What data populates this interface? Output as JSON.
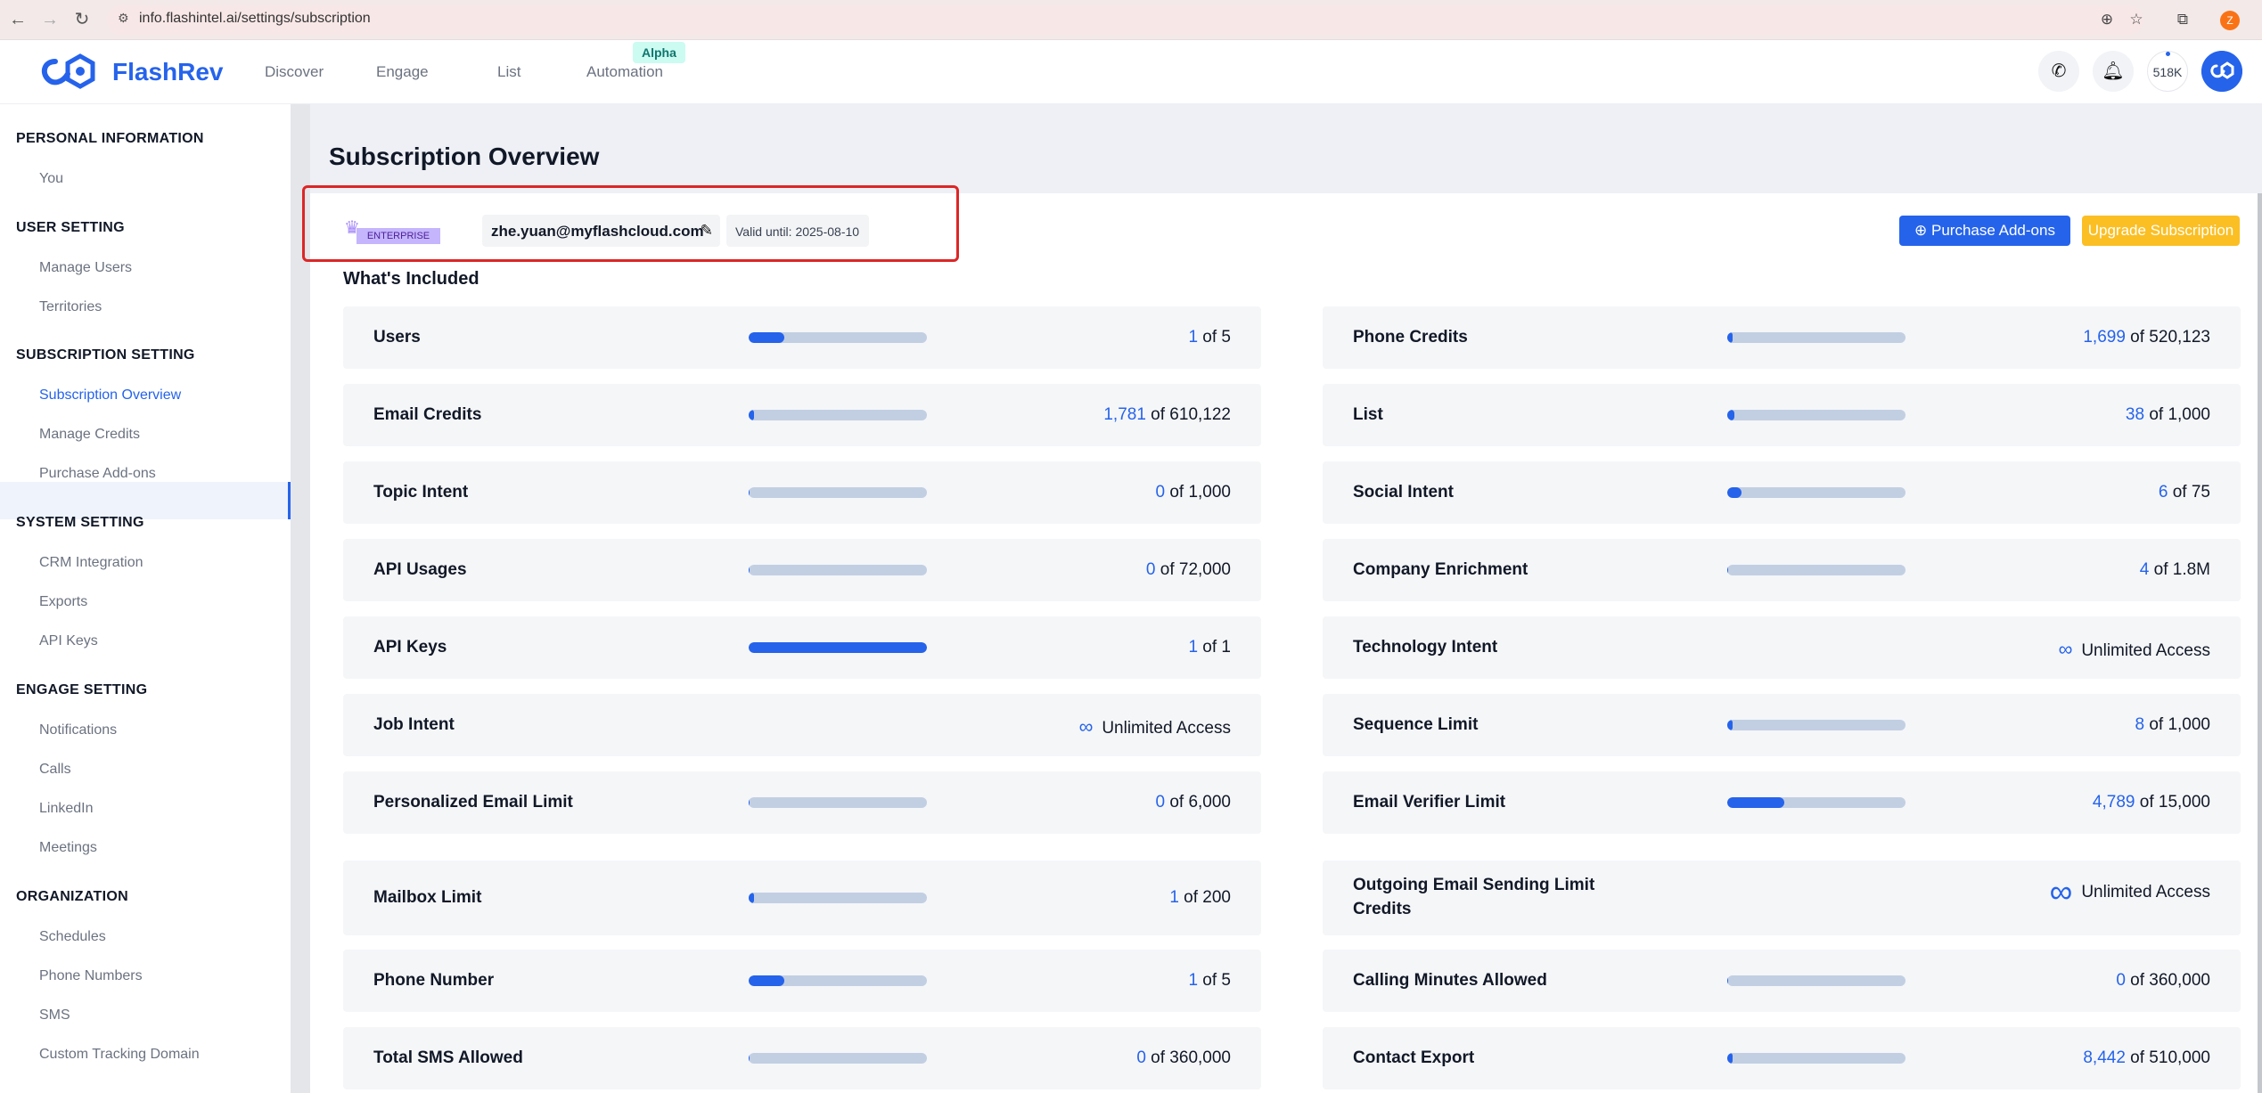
{
  "browser": {
    "url": "info.flashintel.ai/settings/subscription",
    "profile_initial": "Z"
  },
  "app": {
    "brand": "FlashRev",
    "nav": [
      "Discover",
      "Engage",
      "List",
      "Automation"
    ],
    "alpha_badge": "Alpha",
    "credits": "518K",
    "brand_color": "#2563eb"
  },
  "sidebar": {
    "sections": [
      {
        "title": "PERSONAL INFORMATION",
        "items": [
          "You"
        ]
      },
      {
        "title": "USER SETTING",
        "items": [
          "Manage Users",
          "Territories"
        ]
      },
      {
        "title": "SUBSCRIPTION SETTING",
        "items": [
          "Subscription Overview",
          "Manage Credits",
          "Purchase Add-ons"
        ]
      },
      {
        "title": "SYSTEM SETTING",
        "items": [
          "CRM Integration",
          "Exports",
          "API Keys"
        ]
      },
      {
        "title": "ENGAGE SETTING",
        "items": [
          "Notifications",
          "Calls",
          "LinkedIn",
          "Meetings"
        ]
      },
      {
        "title": "ORGANIZATION",
        "items": [
          "Schedules",
          "Phone Numbers",
          "SMS",
          "Custom Tracking Domain"
        ]
      }
    ],
    "active_item": "Subscription Overview"
  },
  "page": {
    "title": "Subscription Overview",
    "plan_badge": "ENTERPRISE",
    "email": "zhe.yuan@myflashcloud.com",
    "valid_until": "Valid until: 2025-08-10",
    "purchase_button": "Purchase Add-ons",
    "upgrade_button": "Upgrade Subscription",
    "included_title": "What's Included",
    "unlimited_text": "Unlimited Access"
  },
  "usage_left": [
    {
      "label": "Users",
      "used": "1",
      "total": "of 5",
      "fraction": 0.2
    },
    {
      "label": "Email Credits",
      "used": "1,781",
      "total": "of 610,122",
      "fraction": 0.003
    },
    {
      "label": "Topic Intent",
      "used": "0",
      "total": "of 1,000",
      "fraction": 0
    },
    {
      "label": "API Usages",
      "used": "0",
      "total": "of 72,000",
      "fraction": 0
    },
    {
      "label": "API Keys",
      "used": "1",
      "total": "of 1",
      "fraction": 1
    },
    {
      "label": "Job Intent",
      "unlimited": true
    },
    {
      "label": "Personalized Email Limit",
      "used": "0",
      "total": "of 6,000",
      "fraction": 0
    },
    {
      "label": "Mailbox Limit",
      "used": "1",
      "total": "of 200",
      "fraction": 0.005
    },
    {
      "label": "Phone Number",
      "used": "1",
      "total": "of 5",
      "fraction": 0.2
    },
    {
      "label": "Total SMS Allowed",
      "used": "0",
      "total": "of 360,000",
      "fraction": 0
    }
  ],
  "usage_right": [
    {
      "label": "Phone Credits",
      "used": "1,699",
      "total": "of 520,123",
      "fraction": 0.003
    },
    {
      "label": "List",
      "used": "38",
      "total": "of 1,000",
      "fraction": 0.038
    },
    {
      "label": "Social Intent",
      "used": "6",
      "total": "of 75",
      "fraction": 0.08
    },
    {
      "label": "Company Enrichment",
      "used": "4",
      "total": "of 1.8M",
      "fraction": 0
    },
    {
      "label": "Technology Intent",
      "unlimited": true
    },
    {
      "label": "Sequence Limit",
      "used": "8",
      "total": "of 1,000",
      "fraction": 0.008
    },
    {
      "label": "Email Verifier Limit",
      "used": "4,789",
      "total": "of 15,000",
      "fraction": 0.319
    },
    {
      "label": "Outgoing Email Sending Limit Credits",
      "unlimited": true
    },
    {
      "label": "Calling Minutes Allowed",
      "used": "0",
      "total": "of 360,000",
      "fraction": 0
    },
    {
      "label": "Contact Export",
      "used": "8,442",
      "total": "of 510,000",
      "fraction": 0.017
    }
  ]
}
